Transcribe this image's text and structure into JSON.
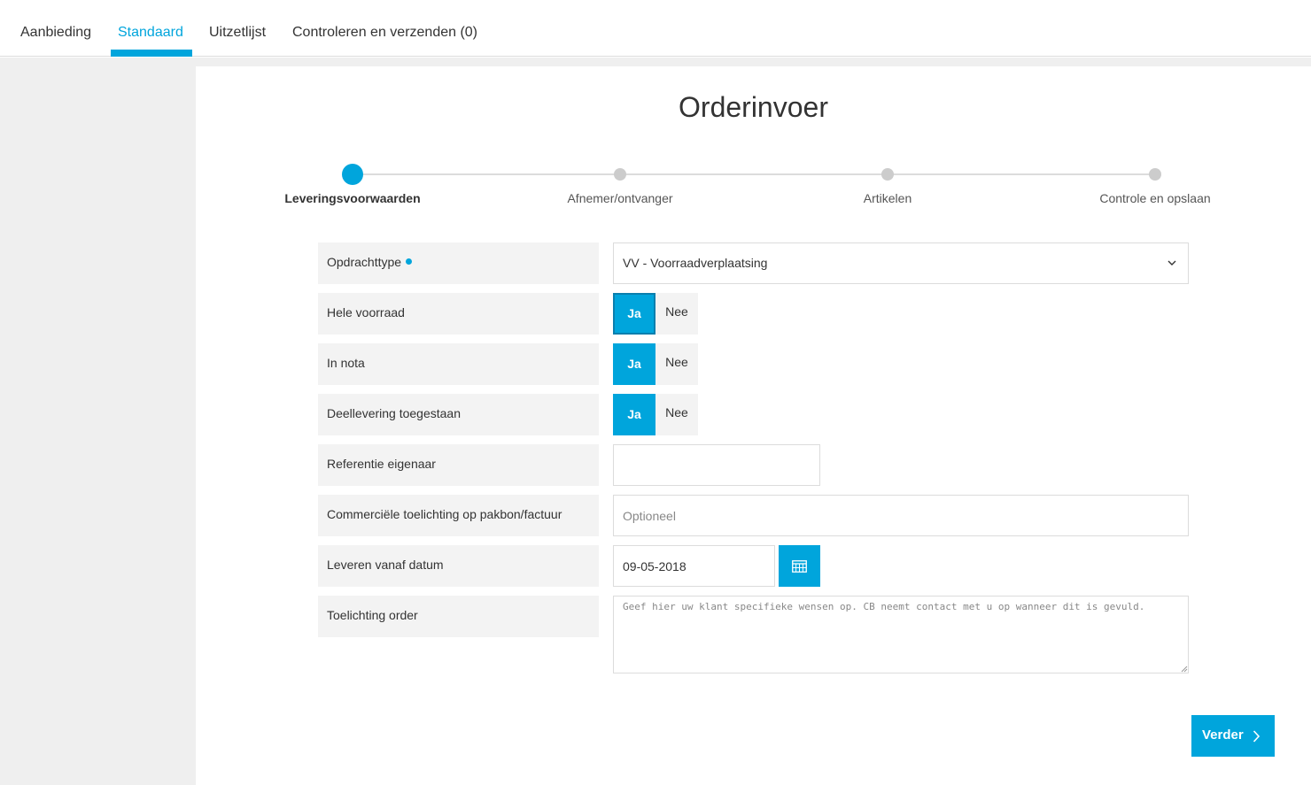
{
  "tabs": [
    {
      "label": "Aanbieding",
      "active": false
    },
    {
      "label": "Standaard",
      "active": true
    },
    {
      "label": "Uitzetlijst",
      "active": false
    },
    {
      "label": "Controleren en verzenden (0)",
      "active": false
    }
  ],
  "page_title": "Orderinvoer",
  "steps": [
    {
      "label": "Leveringsvoorwaarden",
      "active": true
    },
    {
      "label": "Afnemer/ontvanger",
      "active": false
    },
    {
      "label": "Artikelen",
      "active": false
    },
    {
      "label": "Controle en opslaan",
      "active": false
    }
  ],
  "form": {
    "opdrachttype": {
      "label": "Opdrachttype",
      "required": true,
      "value": "VV - Voorraadverplaatsing"
    },
    "hele_voorraad": {
      "label": "Hele voorraad",
      "yes": "Ja",
      "no": "Nee",
      "selected": "Ja"
    },
    "in_nota": {
      "label": "In nota",
      "yes": "Ja",
      "no": "Nee",
      "selected": "Ja"
    },
    "deellevering": {
      "label": "Deellevering toegestaan",
      "yes": "Ja",
      "no": "Nee",
      "selected": "Ja"
    },
    "referentie": {
      "label": "Referentie eigenaar",
      "value": ""
    },
    "commercieel": {
      "label": "Commerciële toelichting op pakbon/factuur",
      "placeholder": "Optioneel",
      "value": ""
    },
    "leverdatum": {
      "label": "Leveren vanaf datum",
      "value": "09-05-2018"
    },
    "toelichting": {
      "label": "Toelichting order",
      "placeholder": "Geef hier uw klant specifieke wensen op. CB neemt contact met u op wanneer dit is gevuld.",
      "value": ""
    }
  },
  "next_button": "Verder",
  "icons": {
    "select_chevron": "chevron-down-icon",
    "calendar": "calendar-icon",
    "next": "chevron-right-icon"
  },
  "colors": {
    "accent": "#00a5dc",
    "label_bg": "#f3f3f3",
    "page_bg": "#efefef"
  }
}
